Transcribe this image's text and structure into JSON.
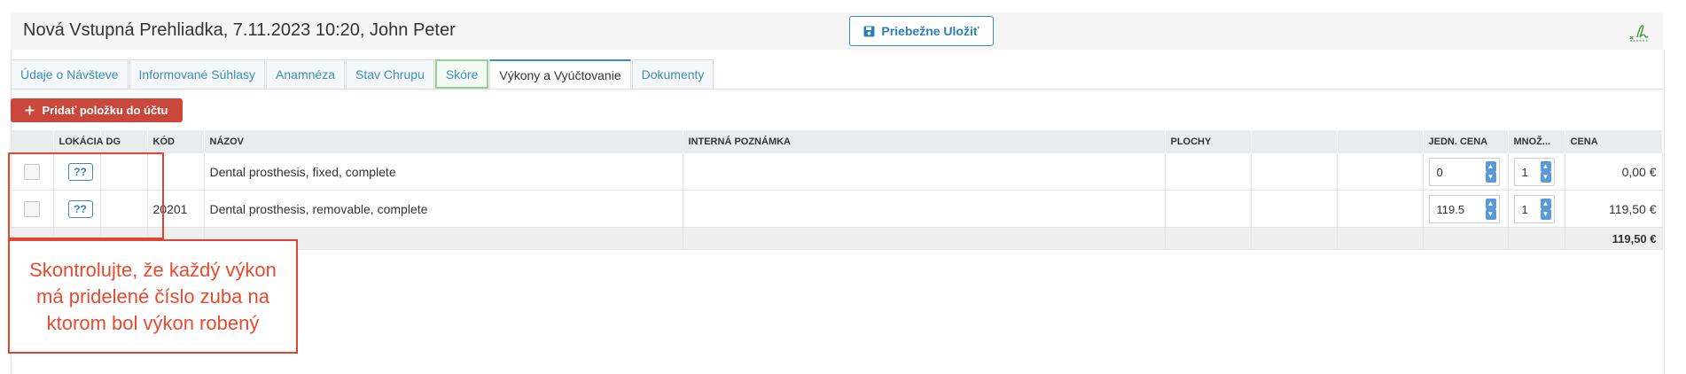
{
  "header": {
    "title": "Nová Vstupná Prehliadka, 7.11.2023 10:20, John Peter",
    "save_button": "Priebežne Uložiť",
    "save_icon": "floppy-disk-icon",
    "sign_icon": "signature-icon"
  },
  "tabs": [
    {
      "label": "Údaje o Návšteve"
    },
    {
      "label": "Informované Súhlasy"
    },
    {
      "label": "Anamnéza"
    },
    {
      "label": "Stav Chrupu"
    },
    {
      "label": "Skóre"
    },
    {
      "label": "Výkony a Vyúčtovanie"
    },
    {
      "label": "Dokumenty"
    }
  ],
  "active_tab": "Výkony a Vyúčtovanie",
  "add_button": {
    "label": "Pridať položku do účtu",
    "icon": "plus-icon"
  },
  "table": {
    "headers": {
      "location": "LOKÁCIA",
      "dg": "DG",
      "code": "KÓD",
      "name": "NÁZOV",
      "note": "INTERNÁ POZNÁMKA",
      "surfaces": "PLOCHY",
      "unit_price": "JEDN. CENA",
      "quantity": "MNOŽ...",
      "price": "CENA"
    },
    "rows": [
      {
        "location": "??",
        "dg": "",
        "code": "",
        "name": "Dental prosthesis, fixed, complete",
        "note": "",
        "surfaces": "",
        "unit_price": "0",
        "quantity": "1",
        "price": "0,00 €"
      },
      {
        "location": "??",
        "dg": "",
        "code": "20201",
        "name": "Dental prosthesis, removable, complete",
        "note": "",
        "surfaces": "",
        "unit_price": "119.5",
        "quantity": "1",
        "price": "119,50 €"
      }
    ],
    "total": "119,50 €"
  },
  "callout": {
    "text": "Skontrolujte, že každý výkon má pridelené číslo zuba na ktorom bol výkon robený",
    "color": "#e0452f"
  },
  "colors": {
    "accent": "#3c8dbc",
    "danger": "#c9483b",
    "score_tab_border": "#8fd48f"
  }
}
